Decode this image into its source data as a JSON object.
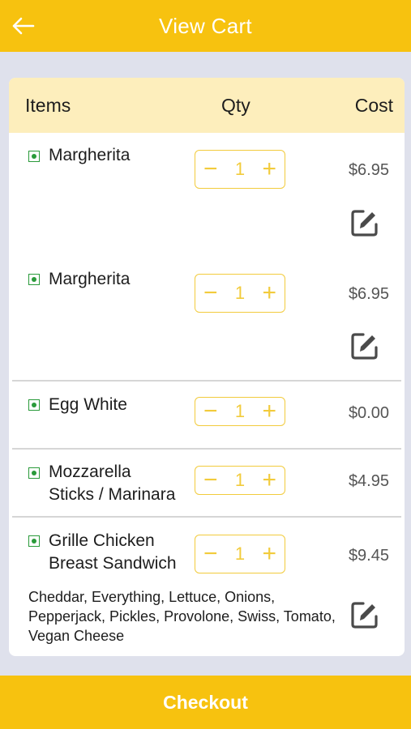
{
  "header": {
    "title": "View Cart",
    "back_icon": "arrow-left-icon"
  },
  "columns": {
    "items": "Items",
    "qty": "Qty",
    "cost": "Cost"
  },
  "items": [
    {
      "name": "Margherita",
      "qty": "1",
      "price": "$6.95",
      "veg": true,
      "editable": true
    },
    {
      "name": "Margherita",
      "qty": "1",
      "price": "$6.95",
      "veg": true,
      "editable": true
    },
    {
      "name": "Egg White",
      "qty": "1",
      "price": "$0.00",
      "veg": true,
      "editable": false
    },
    {
      "name_line1": "Mozzarella",
      "name_line2": "Sticks / Marinara",
      "qty": "1",
      "price": "$4.95",
      "veg": true,
      "editable": false
    },
    {
      "name_line1": "Grille Chicken",
      "name_line2": "Breast Sandwich",
      "qty": "1",
      "price": "$9.45",
      "veg": true,
      "editable": true,
      "modifiers": "Cheddar, Everything, Lettuce, Onions, Pepperjack, Pickles, Provolone, Swiss, Tomato, Vegan Cheese"
    }
  ],
  "stepper": {
    "minus": "−",
    "plus": "+"
  },
  "footer": {
    "checkout_label": "Checkout"
  },
  "colors": {
    "brand": "#f7c20f",
    "header_row": "#fdeebc",
    "veg": "#2a9a3a",
    "stepper": "#f2cb3c"
  }
}
